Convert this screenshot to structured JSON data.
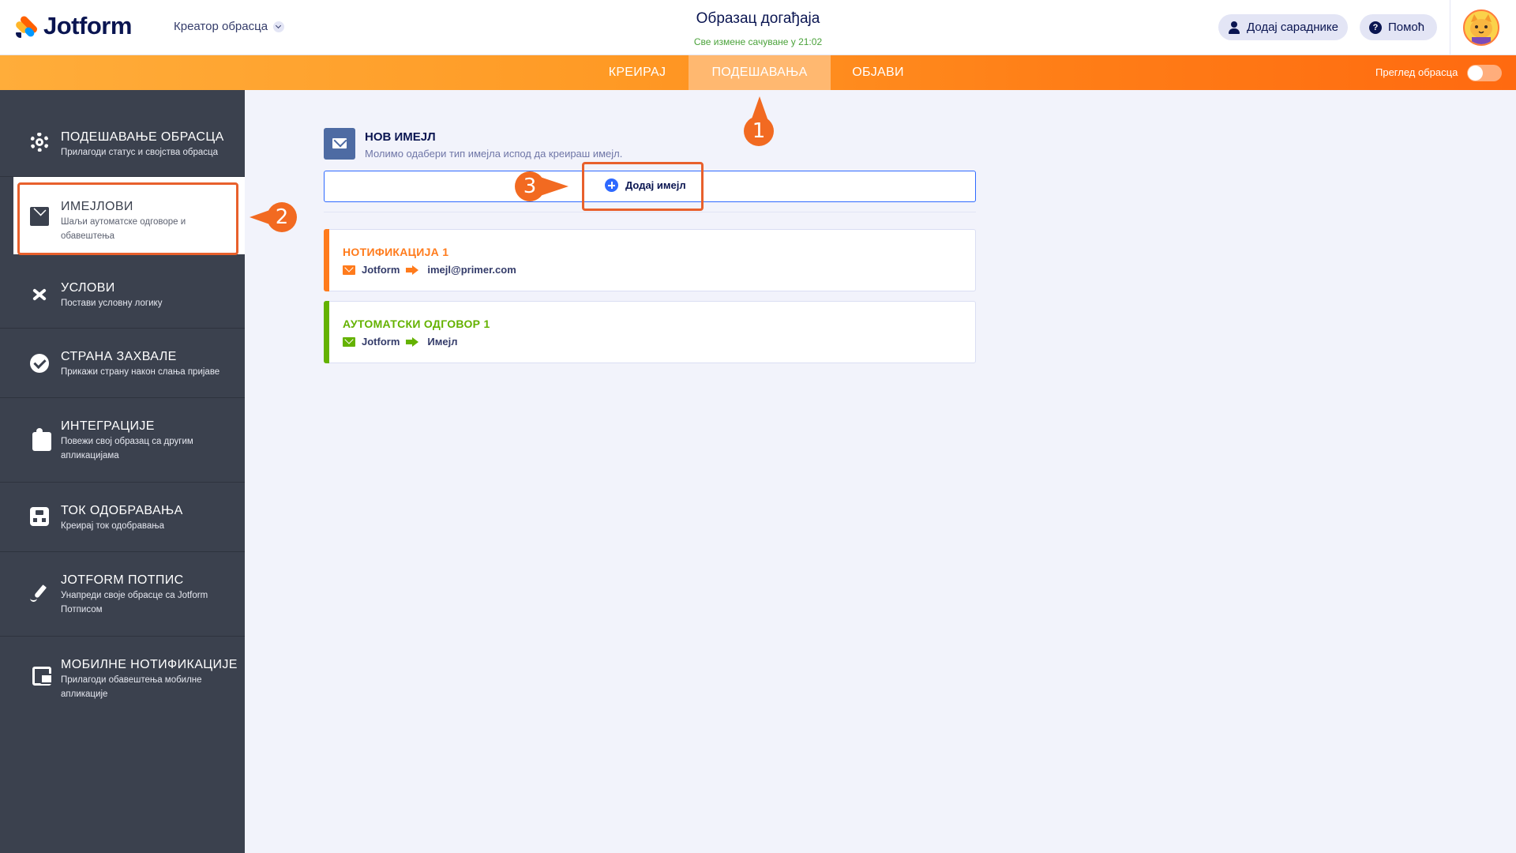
{
  "header": {
    "logo_text": "Jotform",
    "builder_menu": "Креатор обрасца",
    "form_title": "Образац догађаја",
    "save_status": "Све измене сачуване у 21:02",
    "add_collaborators": "Додај сараднике",
    "help": "Помоћ"
  },
  "nav": {
    "tabs": [
      {
        "label": "КРЕИРАЈ",
        "active": false
      },
      {
        "label": "ПОДЕШАВАЊА",
        "active": true
      },
      {
        "label": "ОБЈАВИ",
        "active": false
      }
    ],
    "preview_label": "Преглед обрасца",
    "preview_enabled": false
  },
  "sidebar": {
    "items": [
      {
        "title": "ПОДЕШАВАЊЕ ОБРАСЦА",
        "desc": "Прилагоди статус и својства обрасца",
        "icon": "gear-icon"
      },
      {
        "title": "ИМЕЈЛОВИ",
        "desc": "Шаљи аутоматске одговоре и обавештења",
        "icon": "envelope-icon",
        "active": true
      },
      {
        "title": "УСЛОВИ",
        "desc": "Постави условну логику",
        "icon": "shuffle-icon"
      },
      {
        "title": "СТРАНА ЗАХВАЛЕ",
        "desc": "Прикажи страну након слања пријаве",
        "icon": "check-circle-icon"
      },
      {
        "title": "ИНТЕГРАЦИЈЕ",
        "desc": "Повежи свој образац са другим апликацијама",
        "icon": "puzzle-icon"
      },
      {
        "title": "ТОК ОДОБРАВАЊА",
        "desc": "Креирај ток одобравања",
        "icon": "approval-flow-icon"
      },
      {
        "title": "JOTFORM ПОТПИС",
        "desc": "Унапреди своје обрасце са Jotform Потписом",
        "icon": "pen-icon"
      },
      {
        "title": "МОБИЛНЕ НОТИФИКАЦИЈЕ",
        "desc": "Прилагоди обавештења мобилне апликације",
        "icon": "mobile-icon"
      }
    ]
  },
  "main": {
    "new_email_title": "НОВ ИМЕЈЛ",
    "new_email_subtitle": "Молимо одабери тип имејла испод да креираш имејл.",
    "add_email_label": "Додај имејл",
    "cards": [
      {
        "title": "НОТИФИКАЦИЈА 1",
        "from": "Jotform",
        "to": "imejl@primer.com",
        "color": "#ff7b1c"
      },
      {
        "title": "АУТОМАТСКИ ОДГОВОР 1",
        "from": "Jotform",
        "to": "Имејл",
        "color": "#64b200"
      }
    ]
  },
  "annotations": {
    "step1": "1",
    "step2": "2",
    "step3": "3",
    "color": "#f26a21"
  }
}
